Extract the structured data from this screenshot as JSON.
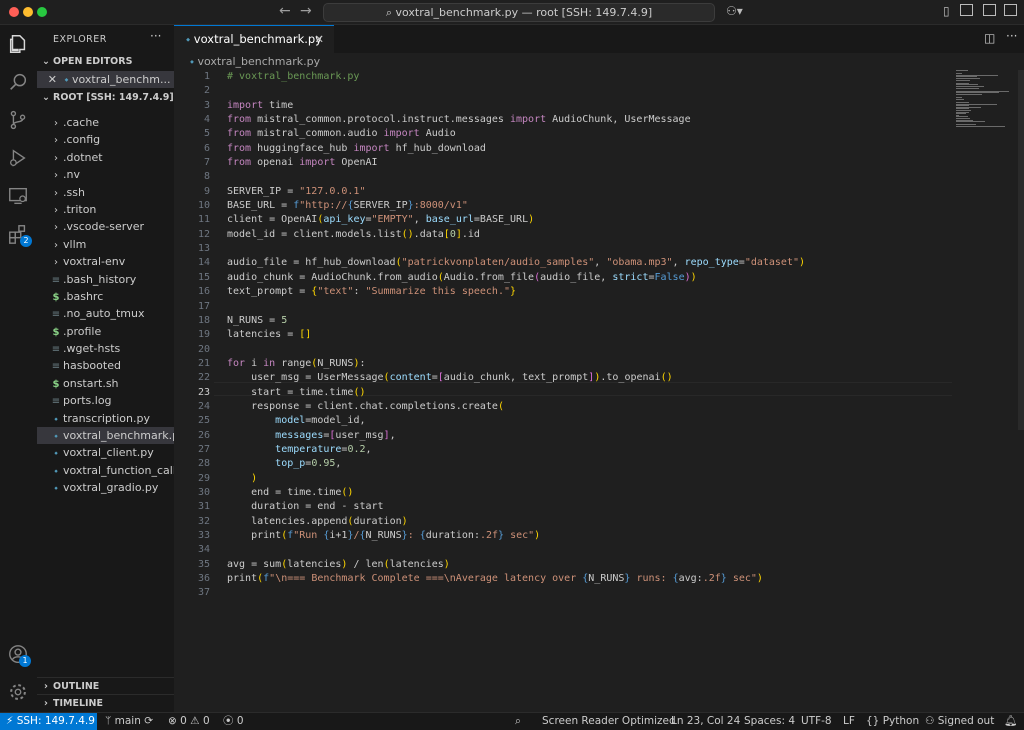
{
  "window": {
    "command_center": "voxtral_benchmark.py — root [SSH: 149.7.4.9]",
    "back_icon": "arrow-left-icon",
    "forward_icon": "arrow-right-icon",
    "accounts_icon": "copilot-icon",
    "signed_out_label": "Signed out"
  },
  "activity": {
    "extensions_badge": "2",
    "accounts_badge": "1"
  },
  "sidebar": {
    "title": "EXPLORER",
    "more": "···",
    "open_editors_label": "OPEN EDITORS",
    "open_editor_file": "voxtral_benchm...",
    "root_label": "ROOT [SSH: 149.7.4.9]",
    "items": [
      {
        "label": ".cache",
        "type": "folder"
      },
      {
        "label": ".config",
        "type": "folder"
      },
      {
        "label": ".dotnet",
        "type": "folder"
      },
      {
        "label": ".nv",
        "type": "folder"
      },
      {
        "label": ".ssh",
        "type": "folder"
      },
      {
        "label": ".triton",
        "type": "folder"
      },
      {
        "label": ".vscode-server",
        "type": "folder"
      },
      {
        "label": "vllm",
        "type": "folder"
      },
      {
        "label": "voxtral-env",
        "type": "folder"
      },
      {
        "label": ".bash_history",
        "type": "file"
      },
      {
        "label": ".bashrc",
        "type": "shell"
      },
      {
        "label": ".no_auto_tmux",
        "type": "file"
      },
      {
        "label": ".profile",
        "type": "shell"
      },
      {
        "label": ".wget-hsts",
        "type": "file"
      },
      {
        "label": "hasbooted",
        "type": "file"
      },
      {
        "label": "onstart.sh",
        "type": "shell"
      },
      {
        "label": "ports.log",
        "type": "file"
      },
      {
        "label": "transcription.py",
        "type": "python"
      },
      {
        "label": "voxtral_benchmark.py",
        "type": "python",
        "selected": true
      },
      {
        "label": "voxtral_client.py",
        "type": "python"
      },
      {
        "label": "voxtral_function_call...",
        "type": "python"
      },
      {
        "label": "voxtral_gradio.py",
        "type": "python"
      }
    ],
    "outline_label": "OUTLINE",
    "timeline_label": "TIMELINE"
  },
  "editor": {
    "tab_label": "voxtral_benchmark.py",
    "breadcrumb": "voxtral_benchmark.py",
    "current_line": 23,
    "lines": [
      [
        [
          "c",
          "# voxtral_benchmark.py"
        ]
      ],
      [],
      [
        [
          "k",
          "import"
        ],
        [
          "p",
          " time"
        ]
      ],
      [
        [
          "k",
          "from"
        ],
        [
          "p",
          " mistral_common.protocol.instruct.messages "
        ],
        [
          "k",
          "import"
        ],
        [
          "p",
          " AudioChunk, UserMessage"
        ]
      ],
      [
        [
          "k",
          "from"
        ],
        [
          "p",
          " mistral_common.audio "
        ],
        [
          "k",
          "import"
        ],
        [
          "p",
          " Audio"
        ]
      ],
      [
        [
          "k",
          "from"
        ],
        [
          "p",
          " huggingface_hub "
        ],
        [
          "k",
          "import"
        ],
        [
          "p",
          " hf_hub_download"
        ]
      ],
      [
        [
          "k",
          "from"
        ],
        [
          "p",
          " openai "
        ],
        [
          "k",
          "import"
        ],
        [
          "p",
          " OpenAI"
        ]
      ],
      [],
      [
        [
          "p",
          "SERVER_IP = "
        ],
        [
          "s",
          "\"127.0.0.1\""
        ]
      ],
      [
        [
          "p",
          "BASE_URL = "
        ],
        [
          "d",
          "f"
        ],
        [
          "s",
          "\"http://"
        ],
        [
          "d",
          "{"
        ],
        [
          "p",
          "SERVER_IP"
        ],
        [
          "d",
          "}"
        ],
        [
          "s",
          ":8000/v1\""
        ]
      ],
      [
        [
          "p",
          "client = OpenAI"
        ],
        [
          "py",
          "("
        ],
        [
          "v",
          "api_key"
        ],
        [
          "p",
          "="
        ],
        [
          "s",
          "\"EMPTY\""
        ],
        [
          "p",
          ", "
        ],
        [
          "v",
          "base_url"
        ],
        [
          "p",
          "=BASE_URL"
        ],
        [
          "py",
          ")"
        ]
      ],
      [
        [
          "p",
          "model_id = client.models.list"
        ],
        [
          "py",
          "("
        ],
        [
          "py",
          ")"
        ],
        [
          "p",
          ".data"
        ],
        [
          "py",
          "["
        ],
        [
          "n",
          "0"
        ],
        [
          "py",
          "]"
        ],
        [
          "p",
          ".id"
        ]
      ],
      [],
      [
        [
          "p",
          "audio_file = hf_hub_download"
        ],
        [
          "py",
          "("
        ],
        [
          "s",
          "\"patrickvonplaten/audio_samples\""
        ],
        [
          "p",
          ", "
        ],
        [
          "s",
          "\"obama.mp3\""
        ],
        [
          "p",
          ", "
        ],
        [
          "v",
          "repo_type"
        ],
        [
          "p",
          "="
        ],
        [
          "s",
          "\"dataset\""
        ],
        [
          "py",
          ")"
        ]
      ],
      [
        [
          "p",
          "audio_chunk = AudioChunk.from_audio"
        ],
        [
          "py",
          "("
        ],
        [
          "p",
          "Audio.from_file"
        ],
        [
          "pb",
          "("
        ],
        [
          "p",
          "audio_file, "
        ],
        [
          "v",
          "strict"
        ],
        [
          "p",
          "="
        ],
        [
          "d",
          "False"
        ],
        [
          "pb",
          ")"
        ],
        [
          "py",
          ")"
        ]
      ],
      [
        [
          "p",
          "text_prompt = "
        ],
        [
          "py",
          "{"
        ],
        [
          "s",
          "\"text\""
        ],
        [
          "p",
          ": "
        ],
        [
          "s",
          "\"Summarize this speech.\""
        ],
        [
          "py",
          "}"
        ]
      ],
      [],
      [
        [
          "p",
          "N_RUNS = "
        ],
        [
          "n",
          "5"
        ]
      ],
      [
        [
          "p",
          "latencies = "
        ],
        [
          "py",
          "["
        ],
        [
          "py",
          "]"
        ]
      ],
      [],
      [
        [
          "k",
          "for"
        ],
        [
          "p",
          " i "
        ],
        [
          "k",
          "in"
        ],
        [
          "p",
          " range"
        ],
        [
          "py",
          "("
        ],
        [
          "p",
          "N_RUNS"
        ],
        [
          "py",
          ")"
        ],
        [
          "p",
          ":"
        ]
      ],
      [
        [
          "p",
          "    user_msg = UserMessage"
        ],
        [
          "py",
          "("
        ],
        [
          "v",
          "content"
        ],
        [
          "p",
          "="
        ],
        [
          "pb",
          "["
        ],
        [
          "p",
          "audio_chunk, text_prompt"
        ],
        [
          "pb",
          "]"
        ],
        [
          "py",
          ")"
        ],
        [
          "p",
          ".to_openai"
        ],
        [
          "py",
          "("
        ],
        [
          "py",
          ")"
        ]
      ],
      [
        [
          "p",
          "    start = time.time"
        ],
        [
          "py",
          "("
        ],
        [
          "py",
          ")"
        ]
      ],
      [
        [
          "p",
          "    response = client.chat.completions.create"
        ],
        [
          "py",
          "("
        ]
      ],
      [
        [
          "p",
          "        "
        ],
        [
          "v",
          "model"
        ],
        [
          "p",
          "=model_id,"
        ]
      ],
      [
        [
          "p",
          "        "
        ],
        [
          "v",
          "messages"
        ],
        [
          "p",
          "="
        ],
        [
          "pb",
          "["
        ],
        [
          "p",
          "user_msg"
        ],
        [
          "pb",
          "]"
        ],
        [
          "p",
          ","
        ]
      ],
      [
        [
          "p",
          "        "
        ],
        [
          "v",
          "temperature"
        ],
        [
          "p",
          "="
        ],
        [
          "n",
          "0.2"
        ],
        [
          "p",
          ","
        ]
      ],
      [
        [
          "p",
          "        "
        ],
        [
          "v",
          "top_p"
        ],
        [
          "p",
          "="
        ],
        [
          "n",
          "0.95"
        ],
        [
          "p",
          ","
        ]
      ],
      [
        [
          "p",
          "    "
        ],
        [
          "py",
          ")"
        ]
      ],
      [
        [
          "p",
          "    end = time.time"
        ],
        [
          "py",
          "("
        ],
        [
          "py",
          ")"
        ]
      ],
      [
        [
          "p",
          "    duration = end - start"
        ]
      ],
      [
        [
          "p",
          "    latencies.append"
        ],
        [
          "py",
          "("
        ],
        [
          "p",
          "duration"
        ],
        [
          "py",
          ")"
        ]
      ],
      [
        [
          "p",
          "    print"
        ],
        [
          "py",
          "("
        ],
        [
          "d",
          "f"
        ],
        [
          "s",
          "\"Run "
        ],
        [
          "d",
          "{"
        ],
        [
          "p",
          "i+1"
        ],
        [
          "d",
          "}"
        ],
        [
          "s",
          "/"
        ],
        [
          "d",
          "{"
        ],
        [
          "p",
          "N_RUNS"
        ],
        [
          "d",
          "}"
        ],
        [
          "s",
          ": "
        ],
        [
          "d",
          "{"
        ],
        [
          "p",
          "duration:"
        ],
        [
          "s",
          ".2f"
        ],
        [
          "d",
          "}"
        ],
        [
          "s",
          " sec\""
        ],
        [
          "py",
          ")"
        ]
      ],
      [],
      [
        [
          "p",
          "avg = sum"
        ],
        [
          "py",
          "("
        ],
        [
          "p",
          "latencies"
        ],
        [
          "py",
          ")"
        ],
        [
          "p",
          " / len"
        ],
        [
          "py",
          "("
        ],
        [
          "p",
          "latencies"
        ],
        [
          "py",
          ")"
        ]
      ],
      [
        [
          "p",
          "print"
        ],
        [
          "py",
          "("
        ],
        [
          "d",
          "f"
        ],
        [
          "s",
          "\"\\n=== Benchmark Complete ===\\nAverage latency over "
        ],
        [
          "d",
          "{"
        ],
        [
          "p",
          "N_RUNS"
        ],
        [
          "d",
          "}"
        ],
        [
          "s",
          " runs: "
        ],
        [
          "d",
          "{"
        ],
        [
          "p",
          "avg:"
        ],
        [
          "s",
          ".2f"
        ],
        [
          "d",
          "}"
        ],
        [
          "s",
          " sec\""
        ],
        [
          "py",
          ")"
        ]
      ],
      []
    ]
  },
  "status": {
    "remote": "SSH: 149.7.4.9",
    "branch": "main",
    "errors": "0",
    "warnings": "0",
    "ports": "0",
    "screen_reader": "Screen Reader Optimized",
    "position": "Ln 23, Col 24",
    "spaces": "Spaces: 4",
    "encoding": "UTF-8",
    "eol": "LF",
    "language": "Python",
    "signed_out": "Signed out"
  },
  "colors": {
    "accent": "#0078d4",
    "keyword": "#c586c0",
    "string": "#ce9178",
    "comment": "#6a9955",
    "parameter": "#9cdcfe",
    "number": "#b5cea8"
  }
}
